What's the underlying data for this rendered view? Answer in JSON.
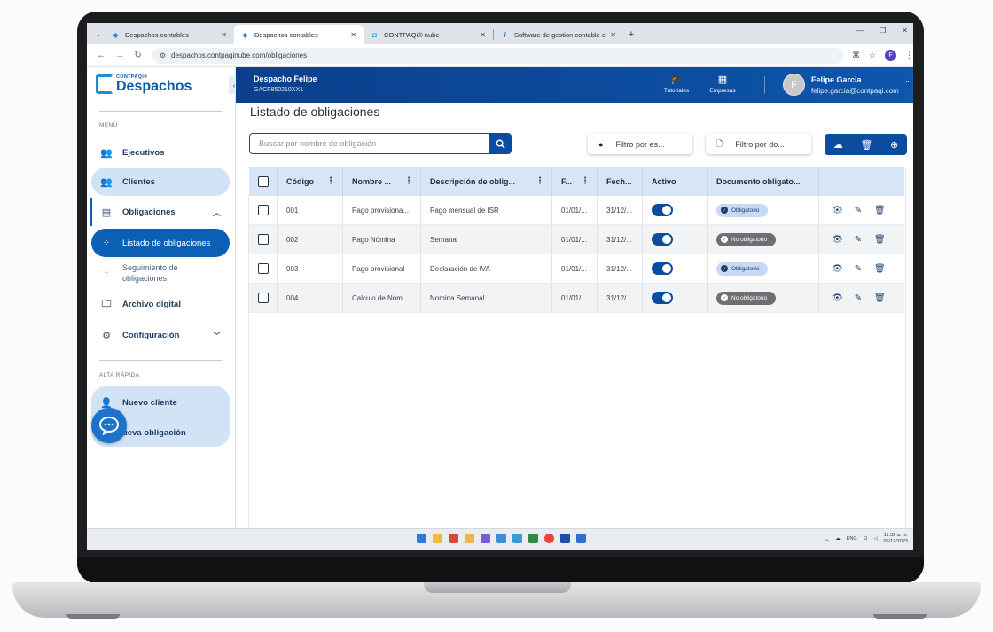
{
  "browser": {
    "tabs": [
      {
        "label": "Despachos contables",
        "active": false,
        "icon": "contpaqi-icon"
      },
      {
        "label": "Despachos contables",
        "active": true,
        "icon": "contpaqi-icon"
      },
      {
        "label": "CONTPAQi® nube",
        "active": false,
        "icon": "contpaqi-nube-icon"
      },
      {
        "label": "Software de gestion contable e",
        "active": false,
        "icon": "info-icon"
      }
    ],
    "url": "despachos.contpaqinube.com/obligaciones",
    "profile_initial": "F"
  },
  "sidebar": {
    "logo_small": "CONTPAQi®",
    "logo_big": "Despachos",
    "menu_label": "MENÚ",
    "items": {
      "ejecutivos": "Ejecutivos",
      "clientes": "Clientes",
      "obligaciones": "Obligaciones",
      "listado": "Listado de obligaciones",
      "seguimiento_1": "Seguimiento de",
      "seguimiento_2": "obligaciones",
      "archivo": "Archivo digital",
      "configuracion": "Configuración"
    },
    "quick_label": "ALTA RÁPIDA",
    "quick": {
      "nuevo_cliente": "Nuevo cliente",
      "nueva_obligacion": "ueva obligación"
    }
  },
  "header": {
    "despacho_name": "Despacho Felipe",
    "despacho_rfc": "GACF850210XX1",
    "tutoriales": "Tutoriales",
    "empresas": "Empresas",
    "avatar_initial": "F",
    "user_name": "Felipe Garcia",
    "user_email": "felipe.garcia@contpaqi.com"
  },
  "main": {
    "title": "Listado de obligaciones",
    "search_placeholder": "Buscar por nombre de obligación",
    "filter_status": "Filtro por es...",
    "filter_doc": "Filtro por do...",
    "columns": {
      "codigo": "Código",
      "nombre": "Nombre ...",
      "descripcion": "Descripción de oblig...",
      "f": "F...",
      "fecha": "Fech...",
      "activo": "Activo",
      "documento": "Documento obligato..."
    },
    "rows": [
      {
        "codigo": "001",
        "nombre": "Pago provisiona...",
        "descripcion": "Pago mensual de ISR",
        "f": "01/01/...",
        "fecha": "31/12/...",
        "activo": true,
        "documento": "Obligatorio",
        "doc_required": true
      },
      {
        "codigo": "002",
        "nombre": "Pago Nómina",
        "descripcion": "Semanal",
        "f": "01/01/...",
        "fecha": "31/12/...",
        "activo": true,
        "documento": "No obligatorio",
        "doc_required": false
      },
      {
        "codigo": "003",
        "nombre": "Pago provisional",
        "descripcion": "Declaración de IVA",
        "f": "01/01/...",
        "fecha": "31/12/...",
        "activo": true,
        "documento": "Obligatorio",
        "doc_required": true
      },
      {
        "codigo": "004",
        "nombre": "Calculo de Nóm...",
        "descripcion": "Nomina Semanal",
        "f": "01/01/...",
        "fecha": "31/12/...",
        "activo": true,
        "documento": "No obligatorio",
        "doc_required": false
      }
    ]
  },
  "taskbar": {
    "lang": "ENG",
    "time": "11:32 a. m.",
    "date": "05/12/2023"
  },
  "colors": {
    "primary": "#0c4c9e",
    "selected_nav": "#0b5fb5",
    "light_nav": "#d3e3f6",
    "table_header": "#d7e6f6"
  }
}
